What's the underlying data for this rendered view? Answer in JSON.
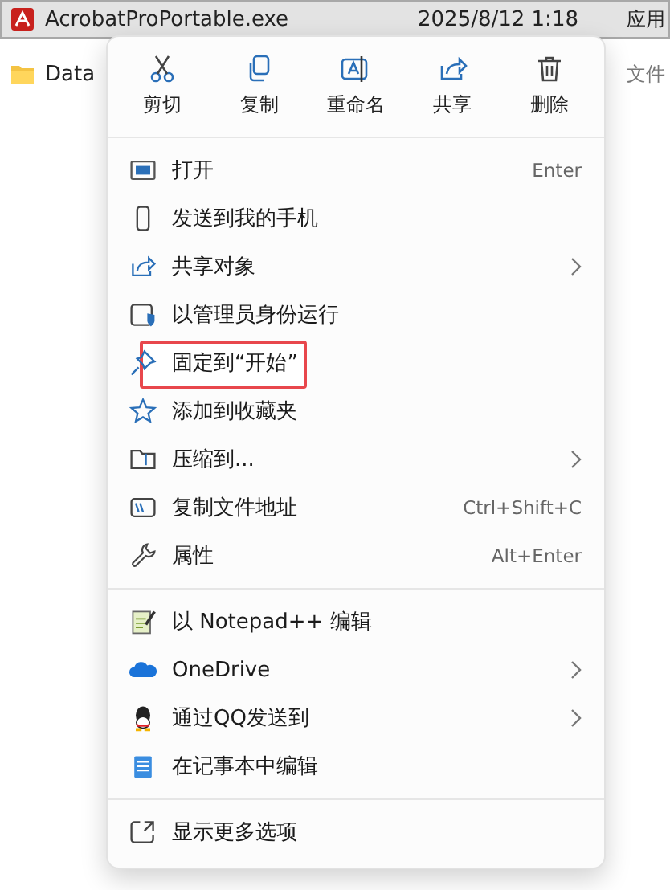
{
  "files": [
    {
      "kind": "pdf",
      "name": "AcrobatProPortable.exe",
      "date": "2025/8/12 1:18",
      "type": "应用",
      "selected": true
    },
    {
      "kind": "folder",
      "name": "Data",
      "type": "文件",
      "selected": false
    }
  ],
  "context_menu": {
    "actions": [
      {
        "label": "剪切"
      },
      {
        "label": "复制"
      },
      {
        "label": "重命名"
      },
      {
        "label": "共享"
      },
      {
        "label": "删除"
      }
    ],
    "groups": [
      [
        {
          "label": "打开",
          "shortcut": "Enter",
          "submenu": false,
          "highlighted": false
        },
        {
          "label": "发送到我的手机",
          "submenu": false,
          "highlighted": false
        },
        {
          "label": "共享对象",
          "submenu": true,
          "highlighted": false
        },
        {
          "label": "以管理员身份运行",
          "submenu": false,
          "highlighted": false
        },
        {
          "label": "固定到“开始”",
          "submenu": false,
          "highlighted": true
        },
        {
          "label": "添加到收藏夹",
          "submenu": false,
          "highlighted": false
        },
        {
          "label": "压缩到...",
          "submenu": true,
          "highlighted": false
        },
        {
          "label": "复制文件地址",
          "shortcut": "Ctrl+Shift+C",
          "submenu": false,
          "highlighted": false
        },
        {
          "label": "属性",
          "shortcut": "Alt+Enter",
          "submenu": false,
          "highlighted": false
        }
      ],
      [
        {
          "label": "以 Notepad++ 编辑",
          "submenu": false,
          "highlighted": false
        },
        {
          "label": "OneDrive",
          "submenu": true,
          "highlighted": false
        },
        {
          "label": "通过QQ发送到",
          "submenu": true,
          "highlighted": false
        },
        {
          "label": "在记事本中编辑",
          "submenu": false,
          "highlighted": false
        }
      ],
      [
        {
          "label": "显示更多选项",
          "submenu": false,
          "highlighted": false
        }
      ]
    ]
  }
}
